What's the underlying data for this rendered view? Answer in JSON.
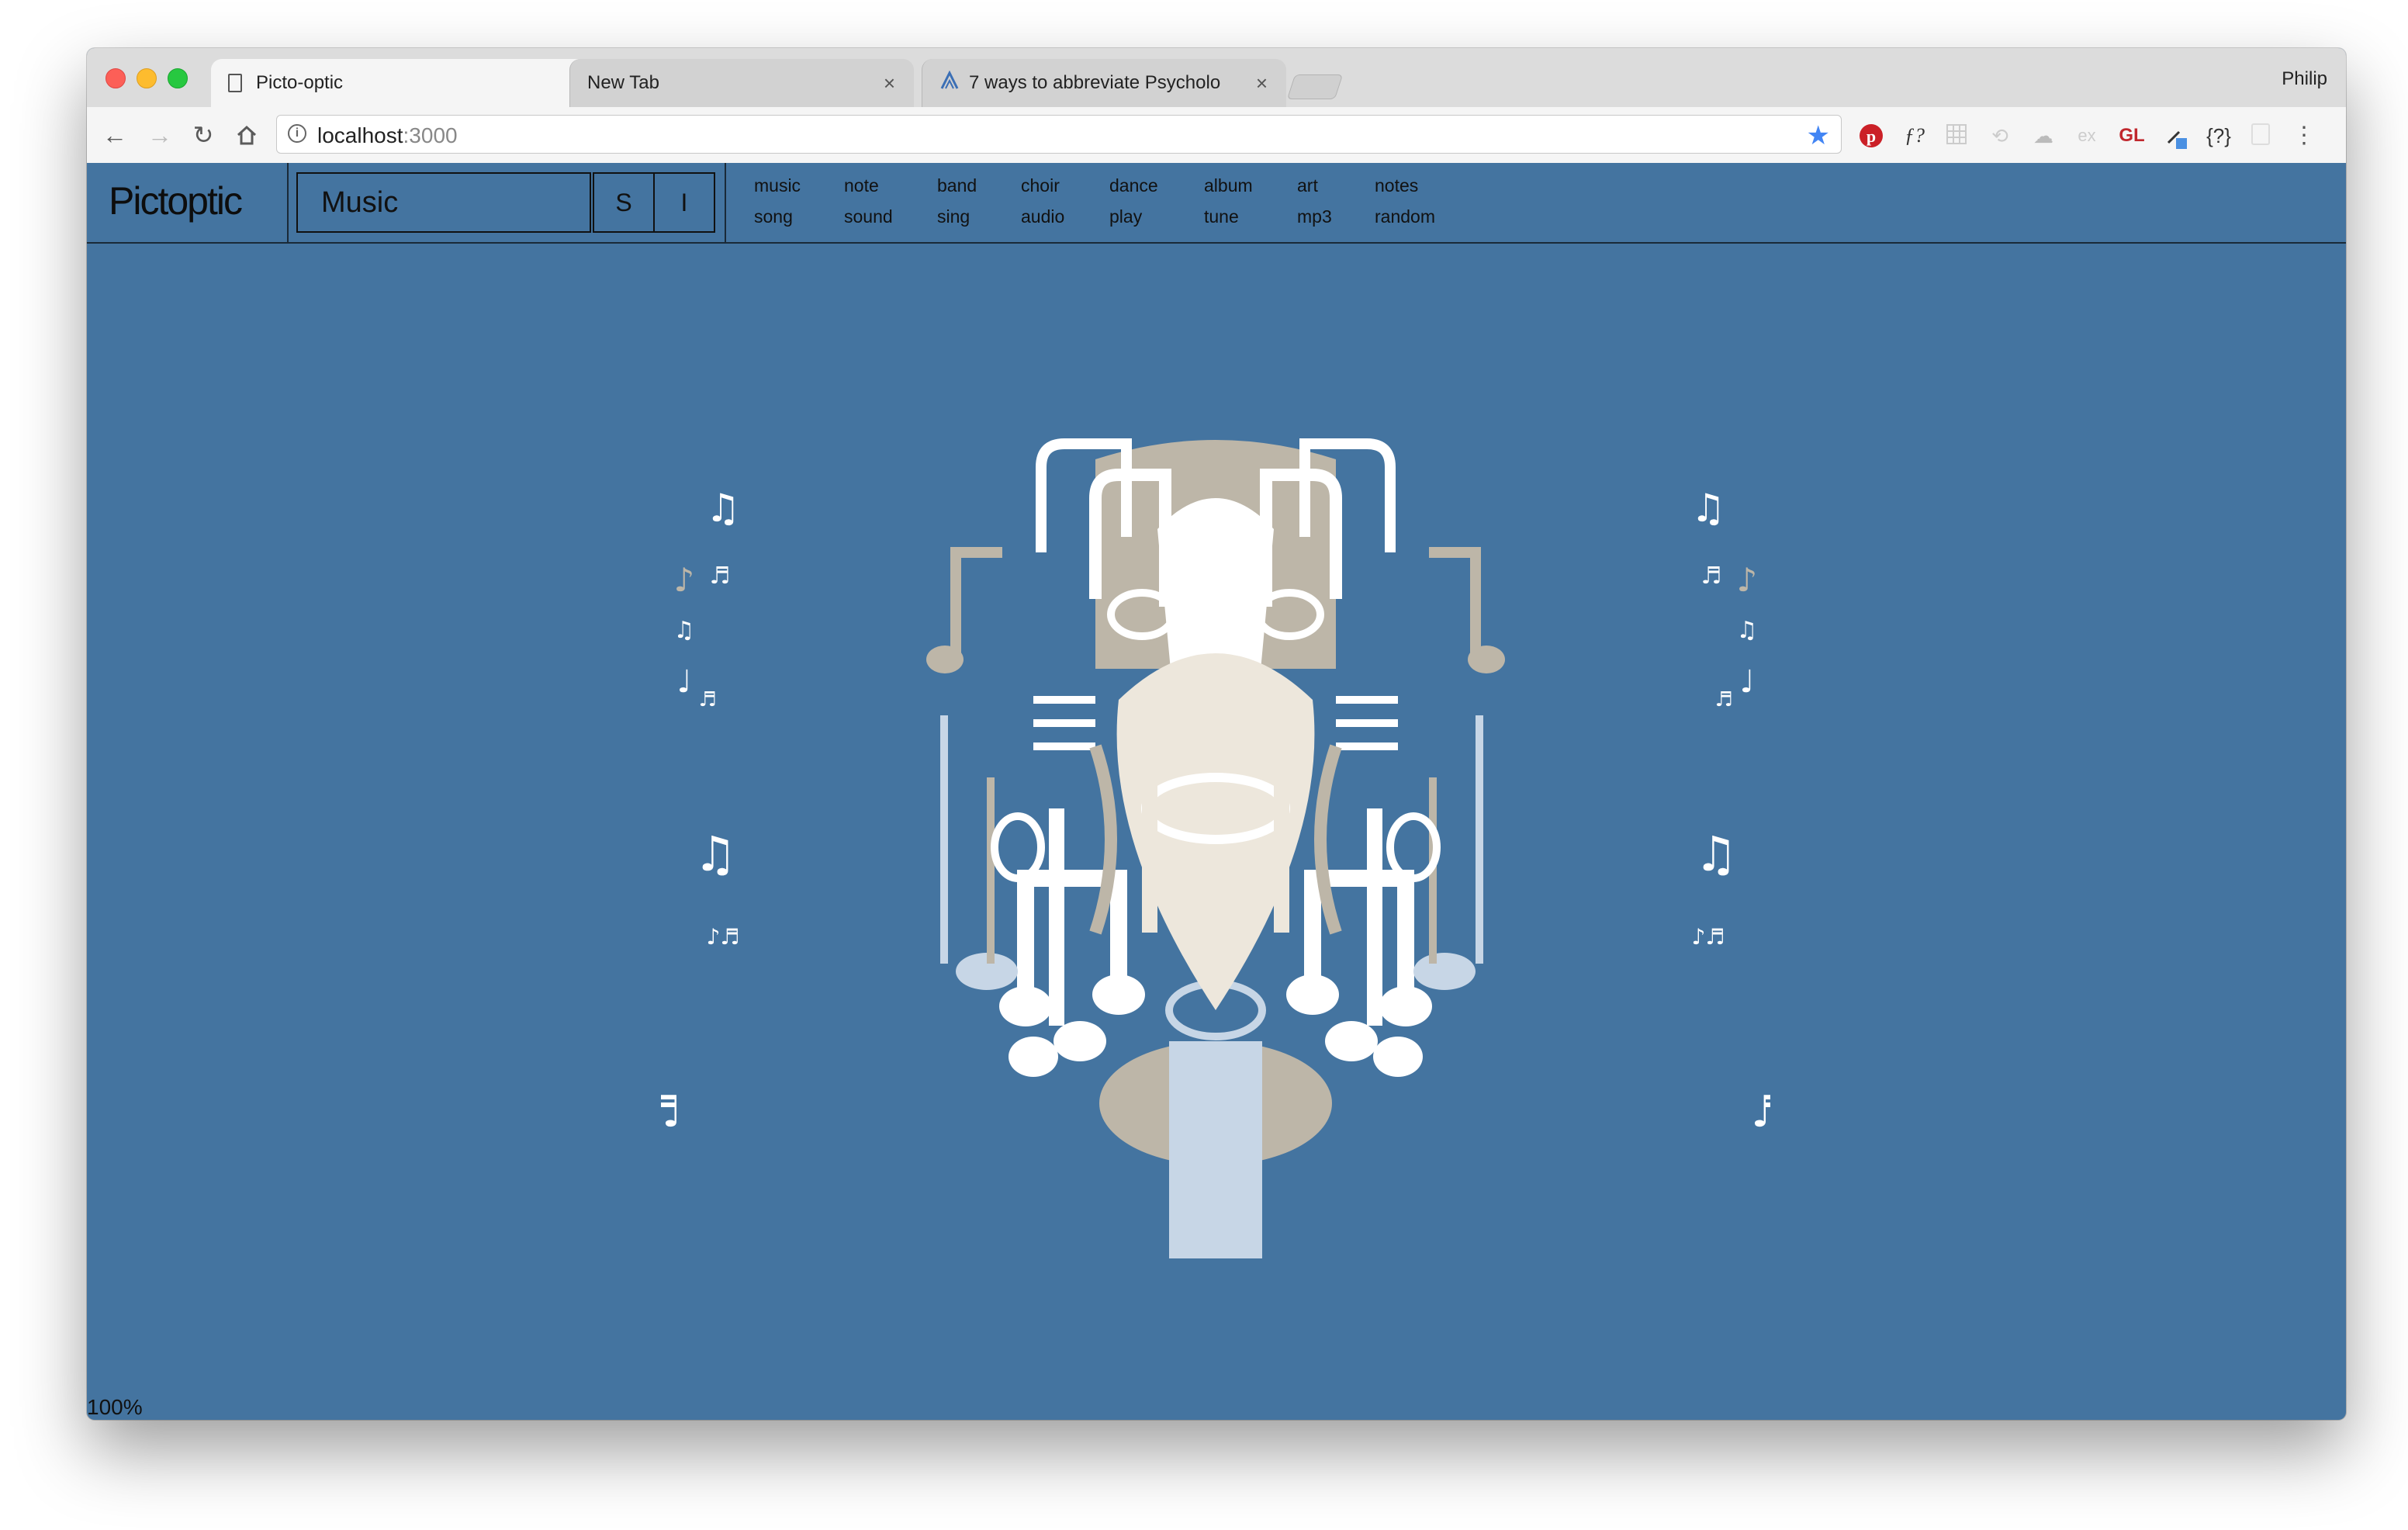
{
  "browser": {
    "tabs": [
      {
        "title": "Picto-optic",
        "active": true
      },
      {
        "title": "New Tab",
        "active": false
      },
      {
        "title": "7 ways to abbreviate Psycholo",
        "active": false
      }
    ],
    "profile_name": "Philip",
    "url_host": "localhost",
    "url_port": ":3000",
    "extensions": [
      "pinterest-icon",
      "fquery-icon",
      "grid-icon",
      "refresh-ext-icon",
      "drive-icon",
      "ex-icon",
      "GL",
      "eyedropper-icon",
      "{?}",
      "page-icon",
      "more-icon"
    ],
    "ext_labels": {
      "f": "ƒ?",
      "ex": "ex",
      "gl": "GL",
      "json": "{?}"
    }
  },
  "app": {
    "logo": "Pictoptic",
    "search_value": "Music",
    "btn_s": "S",
    "btn_i": "I",
    "related_tags": [
      [
        "music",
        "song"
      ],
      [
        "note",
        "sound"
      ],
      [
        "band",
        "sing"
      ],
      [
        "choir",
        "audio"
      ],
      [
        "dance",
        "play"
      ],
      [
        "album",
        "tune"
      ],
      [
        "art",
        "mp3"
      ],
      [
        "notes",
        "random"
      ]
    ],
    "zoom_label": "100%"
  },
  "colors": {
    "background": "#4474a0",
    "art_white": "#ffffff",
    "art_beige": "#bdb6a8",
    "art_light_blue": "#c7d6e6",
    "art_cream": "#ede7dc"
  }
}
